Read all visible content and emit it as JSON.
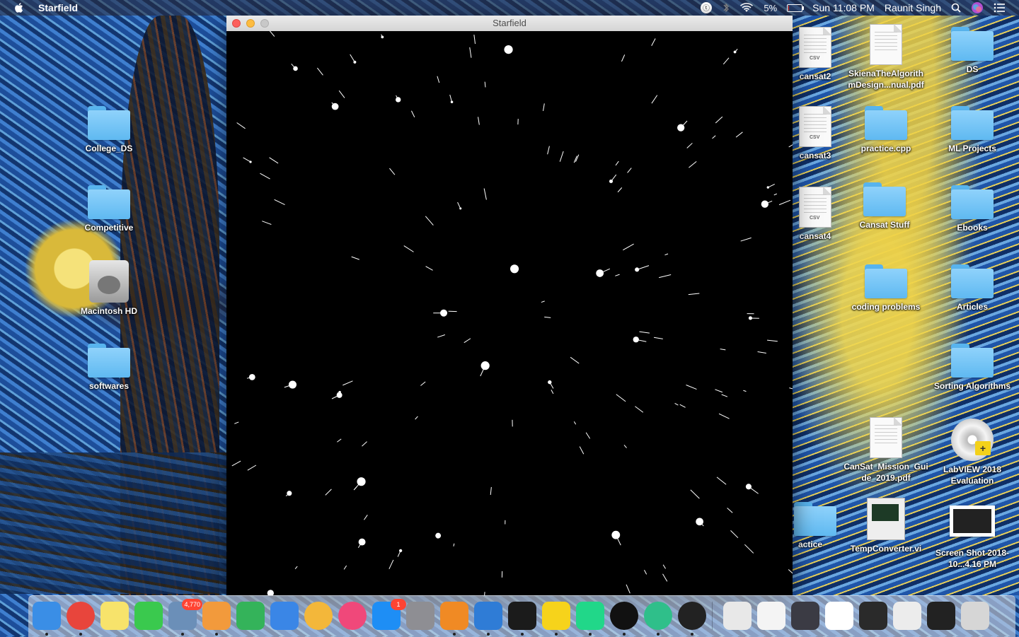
{
  "menubar": {
    "app_name": "Starfield",
    "battery_percent": "5%",
    "battery_level": 0.05,
    "datetime": "Sun 11:08 PM",
    "user": "Raunit Singh"
  },
  "window": {
    "title": "Starfield"
  },
  "desktop_left": [
    {
      "label": "College_DS",
      "kind": "folder"
    },
    {
      "label": "Competitive",
      "kind": "folder"
    },
    {
      "label": "Macintosh HD",
      "kind": "drive"
    },
    {
      "label": "softwares",
      "kind": "folder"
    }
  ],
  "desktop_right": [
    {
      "label": "cansat2",
      "kind": "csv"
    },
    {
      "label": "SkienaTheAlgorithmDesign...nual.pdf",
      "kind": "pdf"
    },
    {
      "label": "DS",
      "kind": "folder"
    },
    {
      "label": "cansat3",
      "kind": "csv"
    },
    {
      "label": "practice.cpp",
      "kind": "folder"
    },
    {
      "label": "ML Projects",
      "kind": "folder"
    },
    {
      "label": "cansat4",
      "kind": "csv"
    },
    {
      "label": "Cansat Stuff",
      "kind": "folder"
    },
    {
      "label": "Ebooks",
      "kind": "folder"
    },
    {
      "label": "coding problems",
      "kind": "folder"
    },
    {
      "label": "Articles",
      "kind": "folder"
    },
    {
      "label": "Sorting Algorithms",
      "kind": "folder"
    },
    {
      "label": "CanSat_Mission_Guide_2019.pdf",
      "kind": "pdf"
    },
    {
      "label": "LabVIEW 2018 Evaluation",
      "kind": "cd"
    },
    {
      "label": "actice",
      "kind": "folder"
    },
    {
      "label": "TempConverter.vi",
      "kind": "vi"
    },
    {
      "label": "Screen Shot 2018-10...4.16 PM",
      "kind": "screenshot"
    }
  ],
  "dock": {
    "apps": [
      {
        "name": "finder-icon",
        "color": "#3a8ee6"
      },
      {
        "name": "chrome-icon",
        "color": "#e8453c"
      },
      {
        "name": "notes-icon",
        "color": "#f7e36b"
      },
      {
        "name": "facetime-icon",
        "color": "#3ac94e"
      },
      {
        "name": "mail-icon",
        "color": "#6b8fb8",
        "badge": "4,770"
      },
      {
        "name": "pages-icon",
        "color": "#f29a3c"
      },
      {
        "name": "numbers-icon",
        "color": "#34b35a"
      },
      {
        "name": "keynote-icon",
        "color": "#3a86e6"
      },
      {
        "name": "photos-icon",
        "color": "#f3b73a"
      },
      {
        "name": "itunes-icon",
        "color": "#f0487a"
      },
      {
        "name": "app-store-icon",
        "color": "#1e8ef5",
        "badge": "1"
      },
      {
        "name": "system-preferences-icon",
        "color": "#8e8e93"
      },
      {
        "name": "ibooks-icon",
        "color": "#f08a24"
      },
      {
        "name": "xcode-icon",
        "color": "#2f7cd6"
      },
      {
        "name": "terminal-icon",
        "color": "#1b1b1b"
      },
      {
        "name": "labview-icon",
        "color": "#f6d31b"
      },
      {
        "name": "pycharm-icon",
        "color": "#21d789"
      },
      {
        "name": "info-icon",
        "color": "#111111"
      },
      {
        "name": "atom-icon",
        "color": "#2fbf8a"
      },
      {
        "name": "quicktime-icon",
        "color": "#222222"
      },
      {
        "name": "downloads-stack-icon",
        "color": "#e8e8e8"
      },
      {
        "name": "document-stack-icon",
        "color": "#f4f4f4"
      },
      {
        "name": "window-thumb-1-icon",
        "color": "#3b3b44"
      },
      {
        "name": "window-thumb-2-icon",
        "color": "#ffffff"
      },
      {
        "name": "window-thumb-3-icon",
        "color": "#2a2a2a"
      },
      {
        "name": "window-thumb-4-icon",
        "color": "#ececec"
      },
      {
        "name": "window-thumb-5-icon",
        "color": "#222222"
      },
      {
        "name": "trash-icon",
        "color": "#d6d6d6"
      }
    ]
  }
}
